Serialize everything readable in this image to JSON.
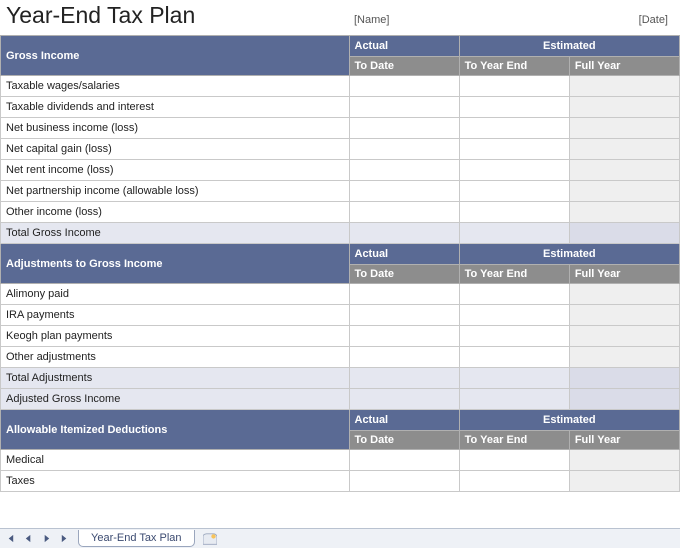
{
  "title": "Year-End Tax Plan",
  "meta": {
    "name": "[Name]",
    "date": "[Date]"
  },
  "columns": {
    "actual": "Actual",
    "estimated": "Estimated",
    "to_date": "To Date",
    "to_year_end": "To Year End",
    "full_year": "Full Year"
  },
  "sections": [
    {
      "heading": "Gross Income",
      "rows": [
        {
          "label": "Taxable wages/salaries",
          "actual": "",
          "to_year_end": "",
          "full_year": ""
        },
        {
          "label": "Taxable dividends and interest",
          "actual": "",
          "to_year_end": "",
          "full_year": ""
        },
        {
          "label": "Net business income (loss)",
          "actual": "",
          "to_year_end": "",
          "full_year": ""
        },
        {
          "label": "Net capital gain (loss)",
          "actual": "",
          "to_year_end": "",
          "full_year": ""
        },
        {
          "label": "Net rent income (loss)",
          "actual": "",
          "to_year_end": "",
          "full_year": ""
        },
        {
          "label": "Net partnership income (allowable loss)",
          "actual": "",
          "to_year_end": "",
          "full_year": ""
        },
        {
          "label": "Other income (loss)",
          "actual": "",
          "to_year_end": "",
          "full_year": ""
        }
      ],
      "totals": [
        {
          "label": "Total Gross Income",
          "actual": "",
          "to_year_end": "",
          "full_year": ""
        }
      ]
    },
    {
      "heading": "Adjustments to Gross Income",
      "rows": [
        {
          "label": "Alimony paid",
          "actual": "",
          "to_year_end": "",
          "full_year": ""
        },
        {
          "label": "IRA payments",
          "actual": "",
          "to_year_end": "",
          "full_year": ""
        },
        {
          "label": "Keogh plan payments",
          "actual": "",
          "to_year_end": "",
          "full_year": ""
        },
        {
          "label": "Other adjustments",
          "actual": "",
          "to_year_end": "",
          "full_year": ""
        }
      ],
      "totals": [
        {
          "label": "Total Adjustments",
          "actual": "",
          "to_year_end": "",
          "full_year": ""
        },
        {
          "label": "Adjusted Gross Income",
          "actual": "",
          "to_year_end": "",
          "full_year": ""
        }
      ]
    },
    {
      "heading": "Allowable Itemized Deductions",
      "rows": [
        {
          "label": "Medical",
          "actual": "",
          "to_year_end": "",
          "full_year": ""
        },
        {
          "label": "Taxes",
          "actual": "",
          "to_year_end": "",
          "full_year": ""
        }
      ],
      "totals": []
    }
  ],
  "sheet_tab": "Year-End Tax Plan"
}
